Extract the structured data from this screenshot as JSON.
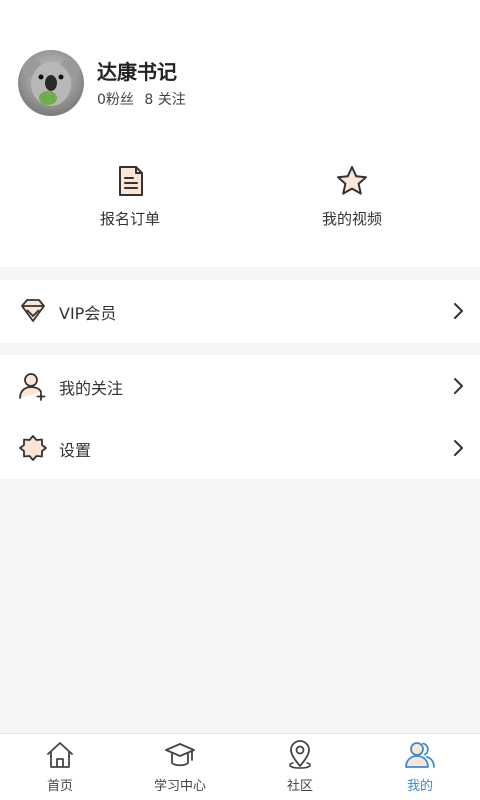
{
  "profile": {
    "name": "达康书记",
    "fans": "0粉丝",
    "following": "8 关注"
  },
  "quick_links": [
    {
      "label": "报名订单",
      "icon": "document-icon"
    },
    {
      "label": "我的视频",
      "icon": "star-icon"
    }
  ],
  "menu": {
    "vip": {
      "label": "VIP会员",
      "icon": "diamond-icon"
    },
    "follow": {
      "label": "我的关注",
      "icon": "user-add-icon"
    },
    "settings": {
      "label": "设置",
      "icon": "settings-icon"
    }
  },
  "tabs": [
    {
      "label": "首页",
      "icon": "home-icon"
    },
    {
      "label": "学习中心",
      "icon": "graduation-cap-icon"
    },
    {
      "label": "社区",
      "icon": "location-pin-icon"
    },
    {
      "label": "我的",
      "icon": "profile-icon",
      "active": true
    }
  ],
  "colors": {
    "accent": "#3a8ad8",
    "icon_fill": "#fbe6d6",
    "icon_stroke": "#333333"
  }
}
